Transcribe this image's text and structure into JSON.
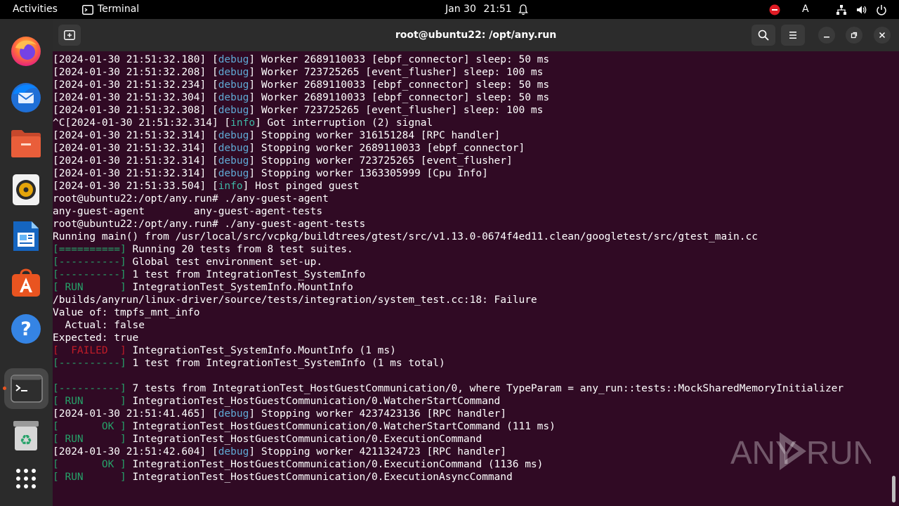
{
  "topbar": {
    "activities": "Activities",
    "app_name": "Terminal",
    "date": "Jan 30",
    "time": "21:51",
    "input_indicator": "A"
  },
  "dock": {
    "items": [
      {
        "name": "firefox-icon"
      },
      {
        "name": "thunderbird-icon"
      },
      {
        "name": "files-icon"
      },
      {
        "name": "rhythmbox-icon"
      },
      {
        "name": "libreoffice-writer-icon"
      },
      {
        "name": "app-center-icon"
      },
      {
        "name": "help-icon"
      },
      {
        "name": "terminal-icon"
      },
      {
        "name": "trash-icon"
      },
      {
        "name": "show-apps-icon"
      }
    ]
  },
  "window": {
    "title": "root@ubuntu22: /opt/any.run"
  },
  "colors": {
    "terminal_bg": "#300a24",
    "debug": "#5fa8d3",
    "info": "#3fb8a6",
    "green": "#26a269",
    "red": "#c01c28"
  },
  "terminal": {
    "lines": [
      [
        {
          "t": "[2024-01-30 21:51:32.180] ["
        },
        {
          "t": "debug",
          "c": "debug"
        },
        {
          "t": "] Worker 2689110033 [ebpf_connector] sleep: 50 ms"
        }
      ],
      [
        {
          "t": "[2024-01-30 21:51:32.208] ["
        },
        {
          "t": "debug",
          "c": "debug"
        },
        {
          "t": "] Worker 723725265 [event_flusher] sleep: 100 ms"
        }
      ],
      [
        {
          "t": "[2024-01-30 21:51:32.234] ["
        },
        {
          "t": "debug",
          "c": "debug"
        },
        {
          "t": "] Worker 2689110033 [ebpf_connector] sleep: 50 ms"
        }
      ],
      [
        {
          "t": "[2024-01-30 21:51:32.304] ["
        },
        {
          "t": "debug",
          "c": "debug"
        },
        {
          "t": "] Worker 2689110033 [ebpf_connector] sleep: 50 ms"
        }
      ],
      [
        {
          "t": "[2024-01-30 21:51:32.308] ["
        },
        {
          "t": "debug",
          "c": "debug"
        },
        {
          "t": "] Worker 723725265 [event_flusher] sleep: 100 ms"
        }
      ],
      [
        {
          "t": "^C[2024-01-30 21:51:32.314] ["
        },
        {
          "t": "info",
          "c": "info"
        },
        {
          "t": "] Got interruption (2) signal"
        }
      ],
      [
        {
          "t": "[2024-01-30 21:51:32.314] ["
        },
        {
          "t": "debug",
          "c": "debug"
        },
        {
          "t": "] Stopping worker 316151284 [RPC handler]"
        }
      ],
      [
        {
          "t": "[2024-01-30 21:51:32.314] ["
        },
        {
          "t": "debug",
          "c": "debug"
        },
        {
          "t": "] Stopping worker 2689110033 [ebpf_connector]"
        }
      ],
      [
        {
          "t": "[2024-01-30 21:51:32.314] ["
        },
        {
          "t": "debug",
          "c": "debug"
        },
        {
          "t": "] Stopping worker 723725265 [event_flusher]"
        }
      ],
      [
        {
          "t": "[2024-01-30 21:51:32.314] ["
        },
        {
          "t": "debug",
          "c": "debug"
        },
        {
          "t": "] Stopping worker 1363305999 [Cpu Info]"
        }
      ],
      [
        {
          "t": "[2024-01-30 21:51:33.504] ["
        },
        {
          "t": "info",
          "c": "info"
        },
        {
          "t": "] Host pinged guest"
        }
      ],
      [
        {
          "t": "root@ubuntu22:/opt/any.run# ./any-guest-agent"
        }
      ],
      [
        {
          "t": "any-guest-agent        any-guest-agent-tests"
        }
      ],
      [
        {
          "t": "root@ubuntu22:/opt/any.run# ./any-guest-agent-tests"
        }
      ],
      [
        {
          "t": "Running main() from /usr/local/src/vcpkg/buildtrees/gtest/src/v1.13.0-0674f4ed11.clean/googletest/src/gtest_main.cc"
        }
      ],
      [
        {
          "t": "[==========]",
          "c": "green"
        },
        {
          "t": " Running 20 tests from 8 test suites."
        }
      ],
      [
        {
          "t": "[----------]",
          "c": "green"
        },
        {
          "t": " Global test environment set-up."
        }
      ],
      [
        {
          "t": "[----------]",
          "c": "green"
        },
        {
          "t": " 1 test from IntegrationTest_SystemInfo"
        }
      ],
      [
        {
          "t": "[ RUN      ]",
          "c": "green"
        },
        {
          "t": " IntegrationTest_SystemInfo.MountInfo"
        }
      ],
      [
        {
          "t": "/builds/anyrun/linux-driver/source/tests/integration/system_test.cc:18: Failure"
        }
      ],
      [
        {
          "t": "Value of: tmpfs_mnt_info"
        }
      ],
      [
        {
          "t": "  Actual: false"
        }
      ],
      [
        {
          "t": "Expected: true"
        }
      ],
      [
        {
          "t": "[  FAILED  ]",
          "c": "red"
        },
        {
          "t": " IntegrationTest_SystemInfo.MountInfo (1 ms)"
        }
      ],
      [
        {
          "t": "[----------]",
          "c": "green"
        },
        {
          "t": " 1 test from IntegrationTest_SystemInfo (1 ms total)"
        }
      ],
      [
        {
          "t": ""
        }
      ],
      [
        {
          "t": "[----------]",
          "c": "green"
        },
        {
          "t": " 7 tests from IntegrationTest_HostGuestCommunication/0, where TypeParam = any_run::tests::MockSharedMemoryInitializer"
        }
      ],
      [
        {
          "t": "[ RUN      ]",
          "c": "green"
        },
        {
          "t": " IntegrationTest_HostGuestCommunication/0.WatcherStartCommand"
        }
      ],
      [
        {
          "t": "[2024-01-30 21:51:41.465] ["
        },
        {
          "t": "debug",
          "c": "debug"
        },
        {
          "t": "] Stopping worker 4237423136 [RPC handler]"
        }
      ],
      [
        {
          "t": "[       OK ]",
          "c": "green"
        },
        {
          "t": " IntegrationTest_HostGuestCommunication/0.WatcherStartCommand (111 ms)"
        }
      ],
      [
        {
          "t": "[ RUN      ]",
          "c": "green"
        },
        {
          "t": " IntegrationTest_HostGuestCommunication/0.ExecutionCommand"
        }
      ],
      [
        {
          "t": "[2024-01-30 21:51:42.604] ["
        },
        {
          "t": "debug",
          "c": "debug"
        },
        {
          "t": "] Stopping worker 4211324723 [RPC handler]"
        }
      ],
      [
        {
          "t": "[       OK ]",
          "c": "green"
        },
        {
          "t": " IntegrationTest_HostGuestCommunication/0.ExecutionCommand (1136 ms)"
        }
      ],
      [
        {
          "t": "[ RUN      ]",
          "c": "green"
        },
        {
          "t": " IntegrationTest_HostGuestCommunication/0.ExecutionAsyncCommand"
        }
      ]
    ]
  },
  "watermark": {
    "text_left": "ANY",
    "text_right": "RUN"
  }
}
